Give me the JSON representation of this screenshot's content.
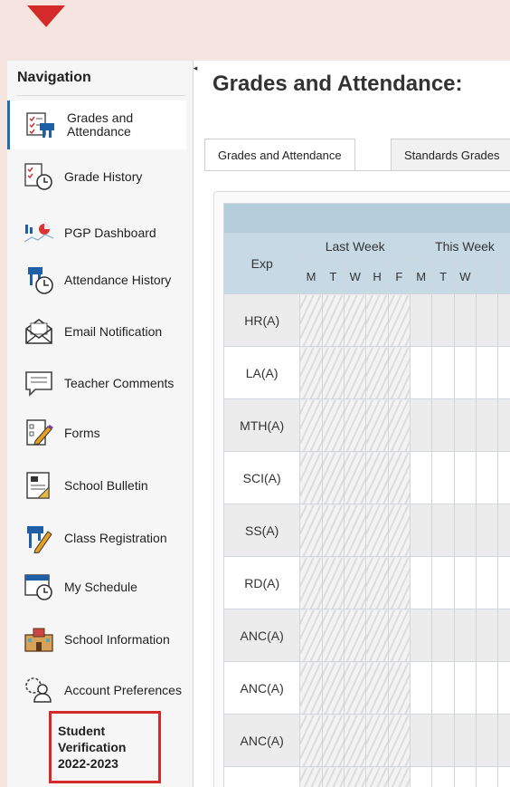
{
  "nav": {
    "title": "Navigation",
    "items": [
      {
        "label": "Grades and Attendance",
        "icon": "gradebook-icon",
        "active": true
      },
      {
        "label": "Grade History",
        "icon": "grade-history-icon"
      },
      {
        "label": "PGP Dashboard",
        "icon": "dashboard-chart-icon"
      },
      {
        "label": "Attendance History",
        "icon": "attendance-history-icon"
      },
      {
        "label": "Email Notification",
        "icon": "envelope-icon"
      },
      {
        "label": "Teacher Comments",
        "icon": "comment-bubble-icon"
      },
      {
        "label": "Forms",
        "icon": "forms-pencil-icon"
      },
      {
        "label": "School Bulletin",
        "icon": "bulletin-board-icon"
      },
      {
        "label": "Class Registration",
        "icon": "class-registration-icon"
      },
      {
        "label": "My Schedule",
        "icon": "schedule-clock-icon"
      },
      {
        "label": "School Information",
        "icon": "school-building-icon"
      },
      {
        "label": "Account Preferences",
        "icon": "account-gear-icon"
      }
    ],
    "highlighted": {
      "lines": [
        "Student",
        "Verification",
        "2022-2023"
      ]
    }
  },
  "main": {
    "title": "Grades and Attendance:",
    "tabs": [
      "Grades and Attendance",
      "Standards Grades"
    ],
    "grid": {
      "exp_header": "Exp",
      "weeks": [
        "Last Week",
        "This Week"
      ],
      "days": [
        "M",
        "T",
        "W",
        "H",
        "F",
        "M",
        "T",
        "W"
      ],
      "rows": [
        "HR(A)",
        "LA(A)",
        "MTH(A)",
        "SCI(A)",
        "SS(A)",
        "RD(A)",
        "ANC(A)",
        "ANC(A)",
        "ANC(A)",
        ""
      ]
    }
  },
  "colors": {
    "accent": "#1a6fa8",
    "highlight_box": "#d42a2a",
    "header": "#c6d9e4"
  }
}
